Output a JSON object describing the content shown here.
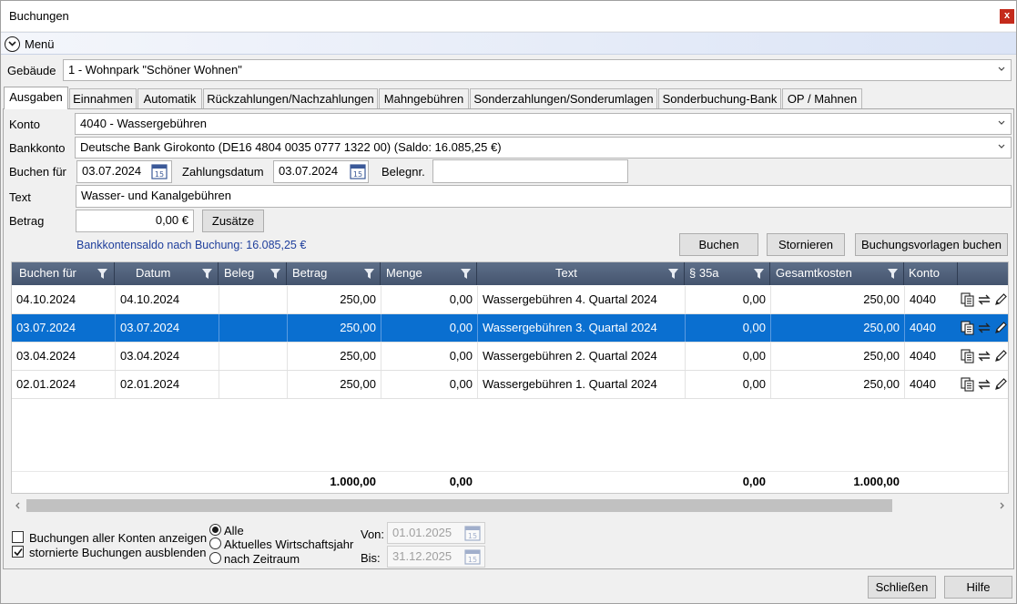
{
  "window": {
    "title": "Buchungen",
    "close": "x"
  },
  "menu": {
    "label": "Menü"
  },
  "gebaeude": {
    "label": "Gebäude",
    "value": "1 - Wohnpark \"Schöner Wohnen\""
  },
  "tabs": [
    {
      "label": "Ausgaben",
      "active": true
    },
    {
      "label": "Einnahmen"
    },
    {
      "label": "Automatik"
    },
    {
      "label": "Rückzahlungen/Nachzahlungen"
    },
    {
      "label": "Mahngebühren"
    },
    {
      "label": "Sonderzahlungen/Sonderumlagen"
    },
    {
      "label": "Sonderbuchung-Bank"
    },
    {
      "label": "OP / Mahnen"
    }
  ],
  "form": {
    "konto_label": "Konto",
    "konto_value": "4040 - Wassergebühren",
    "bankkonto_label": "Bankkonto",
    "bankkonto_value": "Deutsche Bank Girokonto (DE16 4804 0035 0777 1322 00) (Saldo: 16.085,25 €)",
    "buchen_fuer_label": "Buchen für",
    "buchen_fuer_value": "03.07.2024",
    "zahlungsdatum_label": "Zahlungsdatum",
    "zahlungsdatum_value": "03.07.2024",
    "belegnr_label": "Belegnr.",
    "belegnr_value": "",
    "text_label": "Text",
    "text_value": "Wasser- und Kanalgebühren",
    "betrag_label": "Betrag",
    "betrag_value": "0,00 €",
    "zusaetze_button": "Zusätze",
    "saldo_text": "Bankkontensaldo nach Buchung: 16.085,25 €",
    "calendar_day": "15"
  },
  "actions": {
    "buchen": "Buchen",
    "stornieren": "Stornieren",
    "vorlagen": "Buchungsvorlagen buchen"
  },
  "grid": {
    "columns": [
      "Buchen für",
      "Datum",
      "Beleg",
      "Betrag",
      "Menge",
      "Text",
      "§ 35a",
      "Gesamtkosten",
      "Konto"
    ],
    "rows": [
      {
        "buchen_fuer": "04.10.2024",
        "datum": "04.10.2024",
        "beleg": "",
        "betrag": "250,00",
        "menge": "0,00",
        "text": "Wassergebühren 4. Quartal 2024",
        "p35a": "0,00",
        "gesamtkosten": "250,00",
        "konto": "4040",
        "selected": false
      },
      {
        "buchen_fuer": "03.07.2024",
        "datum": "03.07.2024",
        "beleg": "",
        "betrag": "250,00",
        "menge": "0,00",
        "text": "Wassergebühren 3. Quartal 2024",
        "p35a": "0,00",
        "gesamtkosten": "250,00",
        "konto": "4040",
        "selected": true
      },
      {
        "buchen_fuer": "03.04.2024",
        "datum": "03.04.2024",
        "beleg": "",
        "betrag": "250,00",
        "menge": "0,00",
        "text": "Wassergebühren 2. Quartal 2024",
        "p35a": "0,00",
        "gesamtkosten": "250,00",
        "konto": "4040",
        "selected": false
      },
      {
        "buchen_fuer": "02.01.2024",
        "datum": "02.01.2024",
        "beleg": "",
        "betrag": "250,00",
        "menge": "0,00",
        "text": "Wassergebühren 1. Quartal 2024",
        "p35a": "0,00",
        "gesamtkosten": "250,00",
        "konto": "4040",
        "selected": false
      }
    ],
    "totals": {
      "betrag": "1.000,00",
      "menge": "0,00",
      "p35a": "0,00",
      "gesamtkosten": "1.000,00"
    },
    "row_icons": [
      "copy-icon",
      "transfer-icon",
      "edit-icon"
    ]
  },
  "filters": {
    "alle_konten": "Buchungen aller Konten anzeigen",
    "stornierte": "stornierte Buchungen ausblenden",
    "radio_alle": "Alle",
    "radio_wirtschaftsjahr": "Aktuelles Wirtschaftsjahr",
    "radio_zeitraum": "nach Zeitraum",
    "von_label": "Von:",
    "von_value": "01.01.2025",
    "bis_label": "Bis:",
    "bis_value": "31.12.2025"
  },
  "footer": {
    "schliessen": "Schließen",
    "hilfe": "Hilfe"
  },
  "colors": {
    "header": "#4f5f7a",
    "selected_row": "#0a6fd0",
    "saldo_text": "#1f3f9c"
  }
}
